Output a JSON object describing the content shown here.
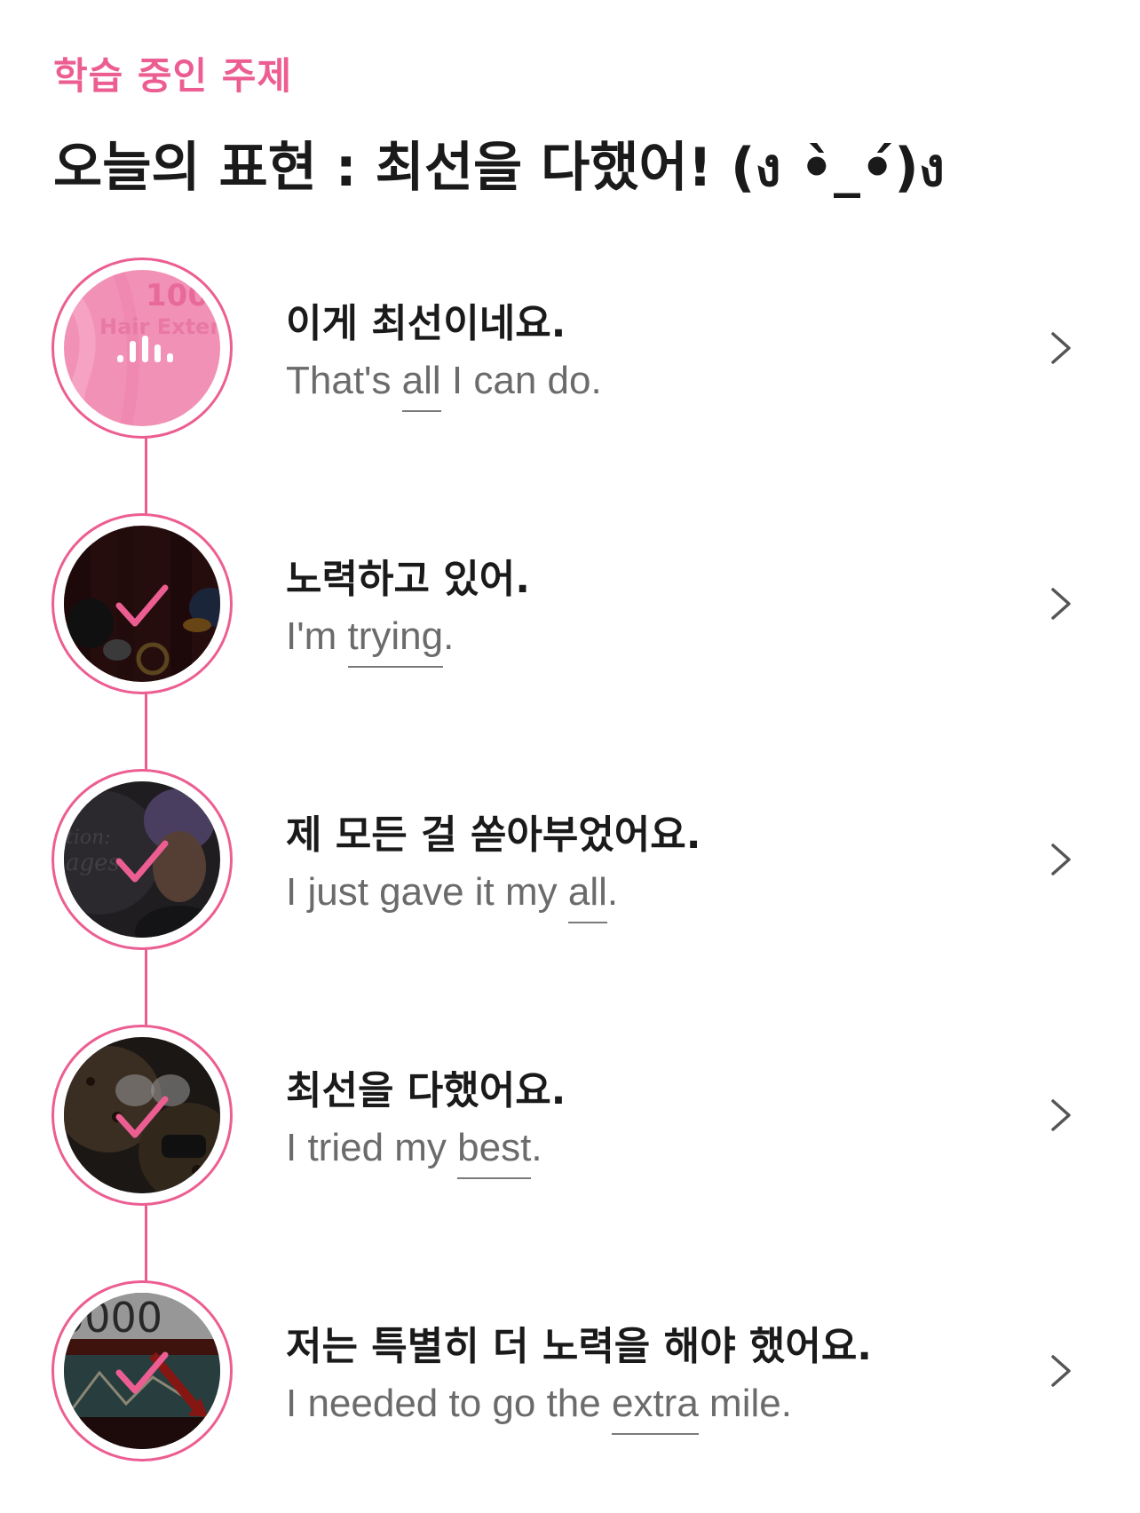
{
  "header": {
    "eyebrow": "학습 중인 주제",
    "title": "오늘의 표현 : 최선을 다했어! (ง •̀_•́)ง"
  },
  "colors": {
    "accent": "#ec5e92",
    "text": "#1a1a1a",
    "subtext": "#6b6b6b"
  },
  "items": [
    {
      "ko": "이게 최선이네요.",
      "en_pre": "That's ",
      "en_kw": "all",
      "en_post": " I can do.",
      "state": "playing",
      "status_icon": "audio-bars-icon"
    },
    {
      "ko": "노력하고 있어.",
      "en_pre": "I'm ",
      "en_kw": "trying",
      "en_post": ".",
      "state": "done",
      "status_icon": "check-icon"
    },
    {
      "ko": "제 모든 걸 쏟아부었어요.",
      "en_pre": "I just gave it my ",
      "en_kw": "all",
      "en_post": ".",
      "state": "done",
      "status_icon": "check-icon"
    },
    {
      "ko": "최선을 다했어요.",
      "en_pre": "I tried my ",
      "en_kw": "best",
      "en_post": ".",
      "state": "done",
      "status_icon": "check-icon"
    },
    {
      "ko": "저는 특별히 더 노력을 해야 했어요.",
      "en_pre": "I needed to go the ",
      "en_kw": "extra",
      "en_post": " mile.",
      "state": "done",
      "status_icon": "check-icon"
    }
  ]
}
